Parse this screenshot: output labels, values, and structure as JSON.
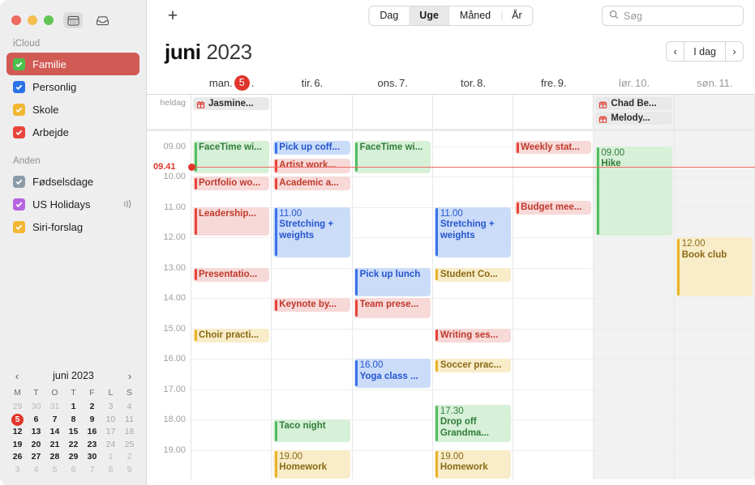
{
  "window": {
    "traffic": [
      "close",
      "minimize",
      "zoom"
    ],
    "tabs": [
      {
        "name": "calendar-view-button",
        "icon": "calendar-icon",
        "active": true
      },
      {
        "name": "inbox-button",
        "icon": "inbox-icon",
        "active": false
      }
    ]
  },
  "sidebar": {
    "sections": [
      {
        "title": "iCloud",
        "calendars": [
          {
            "label": "Familie",
            "color": "#4cc14c",
            "checked": true,
            "selected": true,
            "shared": false
          },
          {
            "label": "Personlig",
            "color": "#2a72e8",
            "checked": true,
            "selected": false,
            "shared": false
          },
          {
            "label": "Skole",
            "color": "#f2b633",
            "checked": true,
            "selected": false,
            "shared": false
          },
          {
            "label": "Arbejde",
            "color": "#e8443a",
            "checked": true,
            "selected": false,
            "shared": false
          }
        ]
      },
      {
        "title": "Anden",
        "calendars": [
          {
            "label": "Fødselsdage",
            "color": "#8c9aa8",
            "checked": true,
            "selected": false,
            "shared": false
          },
          {
            "label": "US Holidays",
            "color": "#b764e0",
            "checked": true,
            "selected": false,
            "shared": true
          },
          {
            "label": "Siri-forslag",
            "color": "#f2b633",
            "checked": true,
            "selected": false,
            "shared": false
          }
        ]
      }
    ]
  },
  "minicalendar": {
    "title": "juni 2023",
    "prev_label": "‹",
    "next_label": "›",
    "dow": [
      "M",
      "T",
      "O",
      "T",
      "F",
      "L",
      "S"
    ],
    "weeks": [
      [
        {
          "d": "29",
          "s": "dim"
        },
        {
          "d": "30",
          "s": "dim"
        },
        {
          "d": "31",
          "s": "dim"
        },
        {
          "d": "1",
          "s": ""
        },
        {
          "d": "2",
          "s": ""
        },
        {
          "d": "3",
          "s": "muted"
        },
        {
          "d": "4",
          "s": "muted"
        }
      ],
      [
        {
          "d": "5",
          "s": "today"
        },
        {
          "d": "6",
          "s": ""
        },
        {
          "d": "7",
          "s": ""
        },
        {
          "d": "8",
          "s": ""
        },
        {
          "d": "9",
          "s": ""
        },
        {
          "d": "10",
          "s": "muted"
        },
        {
          "d": "11",
          "s": "muted"
        }
      ],
      [
        {
          "d": "12",
          "s": ""
        },
        {
          "d": "13",
          "s": ""
        },
        {
          "d": "14",
          "s": ""
        },
        {
          "d": "15",
          "s": ""
        },
        {
          "d": "16",
          "s": ""
        },
        {
          "d": "17",
          "s": "muted"
        },
        {
          "d": "18",
          "s": "muted"
        }
      ],
      [
        {
          "d": "19",
          "s": ""
        },
        {
          "d": "20",
          "s": ""
        },
        {
          "d": "21",
          "s": ""
        },
        {
          "d": "22",
          "s": ""
        },
        {
          "d": "23",
          "s": ""
        },
        {
          "d": "24",
          "s": "muted"
        },
        {
          "d": "25",
          "s": "muted"
        }
      ],
      [
        {
          "d": "26",
          "s": ""
        },
        {
          "d": "27",
          "s": ""
        },
        {
          "d": "28",
          "s": ""
        },
        {
          "d": "29",
          "s": ""
        },
        {
          "d": "30",
          "s": ""
        },
        {
          "d": "1",
          "s": "dim"
        },
        {
          "d": "2",
          "s": "dim"
        }
      ],
      [
        {
          "d": "3",
          "s": "dim"
        },
        {
          "d": "4",
          "s": "dim"
        },
        {
          "d": "5",
          "s": "dim"
        },
        {
          "d": "6",
          "s": "dim"
        },
        {
          "d": "7",
          "s": "dim"
        },
        {
          "d": "8",
          "s": "dim"
        },
        {
          "d": "9",
          "s": "dim"
        }
      ]
    ]
  },
  "toolbar": {
    "add_label": "+",
    "views": [
      {
        "label": "Dag",
        "active": false
      },
      {
        "label": "Uge",
        "active": true
      },
      {
        "label": "Måned",
        "active": false
      },
      {
        "label": "År",
        "active": false
      }
    ],
    "search_placeholder": "Søg",
    "search_value": ""
  },
  "header": {
    "month": "juni",
    "year": "2023",
    "prev_label": "‹",
    "today_label": "I dag",
    "next_label": "›"
  },
  "week": {
    "allday_label": "heldag",
    "days": [
      {
        "label": "man.",
        "num": "5",
        "suffix": ".",
        "today": true,
        "weekend": false
      },
      {
        "label": "tir.",
        "num": "6.",
        "suffix": "",
        "today": false,
        "weekend": false
      },
      {
        "label": "ons.",
        "num": "7.",
        "suffix": "",
        "today": false,
        "weekend": false
      },
      {
        "label": "tor.",
        "num": "8.",
        "suffix": "",
        "today": false,
        "weekend": false
      },
      {
        "label": "fre.",
        "num": "9.",
        "suffix": "",
        "today": false,
        "weekend": false
      },
      {
        "label": "lør.",
        "num": "10.",
        "suffix": "",
        "today": false,
        "weekend": true
      },
      {
        "label": "søn.",
        "num": "11.",
        "suffix": "",
        "today": false,
        "weekend": true
      }
    ],
    "allday_events": [
      {
        "day": 0,
        "title": "Jasmine...",
        "icon": "gift-icon"
      },
      {
        "day": 5,
        "title": "Chad Be...",
        "icon": "gift-icon"
      },
      {
        "day": 5,
        "title": "Melody...",
        "icon": "gift-icon"
      }
    ],
    "hours": [
      "09.00",
      "10.00",
      "11.00",
      "12.00",
      "13.00",
      "14.00",
      "15.00",
      "16.00",
      "17.00",
      "18.00",
      "19.00"
    ],
    "now": {
      "label": "09.41",
      "hour_offset": 0.68
    },
    "events": [
      {
        "day": 0,
        "start": 8.83,
        "end": 9.93,
        "color": "green",
        "time": "",
        "title": "FaceTime wi...",
        "wrap": false
      },
      {
        "day": 0,
        "start": 10.0,
        "end": 10.5,
        "color": "red",
        "time": "",
        "title": "Portfolio wo...",
        "wrap": false
      },
      {
        "day": 0,
        "start": 11.0,
        "end": 12.0,
        "color": "red",
        "time": "",
        "title": "Leadership...",
        "wrap": false
      },
      {
        "day": 0,
        "start": 13.0,
        "end": 13.5,
        "color": "red",
        "time": "",
        "title": "Presentatio...",
        "wrap": false
      },
      {
        "day": 0,
        "start": 15.0,
        "end": 15.5,
        "color": "yellow",
        "time": "",
        "title": "Choir practi...",
        "wrap": false
      },
      {
        "day": 1,
        "start": 8.83,
        "end": 9.33,
        "color": "blue",
        "time": "",
        "title": "Pick up coff...",
        "wrap": false
      },
      {
        "day": 1,
        "start": 9.4,
        "end": 9.95,
        "color": "red",
        "time": "",
        "title": "Artist work...",
        "wrap": false
      },
      {
        "day": 1,
        "start": 10.0,
        "end": 10.5,
        "color": "red",
        "time": "",
        "title": "Academic a...",
        "wrap": false
      },
      {
        "day": 1,
        "start": 11.0,
        "end": 12.7,
        "color": "blue",
        "time": "11.00",
        "title": "Stretching + weights",
        "wrap": true
      },
      {
        "day": 1,
        "start": 14.0,
        "end": 14.5,
        "color": "red",
        "time": "",
        "title": "Keynote by...",
        "wrap": false
      },
      {
        "day": 1,
        "start": 18.0,
        "end": 18.8,
        "color": "green",
        "time": "",
        "title": "Taco night",
        "wrap": false
      },
      {
        "day": 1,
        "start": 19.0,
        "end": 20.0,
        "color": "yellow",
        "time": "19.00",
        "title": "Homework",
        "wrap": true
      },
      {
        "day": 2,
        "start": 8.83,
        "end": 9.93,
        "color": "green",
        "time": "",
        "title": "FaceTime wi...",
        "wrap": false
      },
      {
        "day": 2,
        "start": 13.0,
        "end": 14.0,
        "color": "blue",
        "time": "",
        "title": "Pick up lunch",
        "wrap": false
      },
      {
        "day": 2,
        "start": 14.0,
        "end": 14.7,
        "color": "red",
        "time": "",
        "title": "Team prese...",
        "wrap": false
      },
      {
        "day": 2,
        "start": 16.0,
        "end": 17.0,
        "color": "blue",
        "time": "16.00",
        "title": "Yoga class  ...",
        "wrap": true
      },
      {
        "day": 3,
        "start": 11.0,
        "end": 12.7,
        "color": "blue",
        "time": "11.00",
        "title": "Stretching + weights",
        "wrap": true
      },
      {
        "day": 3,
        "start": 13.0,
        "end": 13.5,
        "color": "yellow",
        "time": "",
        "title": "Student Co...",
        "wrap": false
      },
      {
        "day": 3,
        "start": 15.0,
        "end": 15.5,
        "color": "red",
        "time": "",
        "title": "Writing ses...",
        "wrap": false
      },
      {
        "day": 3,
        "start": 16.0,
        "end": 16.5,
        "color": "yellow",
        "time": "",
        "title": "Soccer prac...",
        "wrap": false
      },
      {
        "day": 3,
        "start": 17.5,
        "end": 18.8,
        "color": "green",
        "time": "17.30",
        "title": "Drop off Grandma...",
        "wrap": true
      },
      {
        "day": 3,
        "start": 19.0,
        "end": 20.0,
        "color": "yellow",
        "time": "19.00",
        "title": "Homework",
        "wrap": true
      },
      {
        "day": 4,
        "start": 8.83,
        "end": 9.3,
        "color": "red",
        "time": "",
        "title": "Weekly stat...",
        "wrap": false
      },
      {
        "day": 4,
        "start": 10.8,
        "end": 11.3,
        "color": "red",
        "time": "",
        "title": "Budget mee...",
        "wrap": false
      },
      {
        "day": 5,
        "start": 9.0,
        "end": 12.0,
        "color": "green",
        "time": "09.00",
        "title": "Hike",
        "wrap": true
      },
      {
        "day": 6,
        "start": 12.0,
        "end": 14.0,
        "color": "yellow",
        "time": "12.00",
        "title": "Book club",
        "wrap": true
      }
    ]
  }
}
